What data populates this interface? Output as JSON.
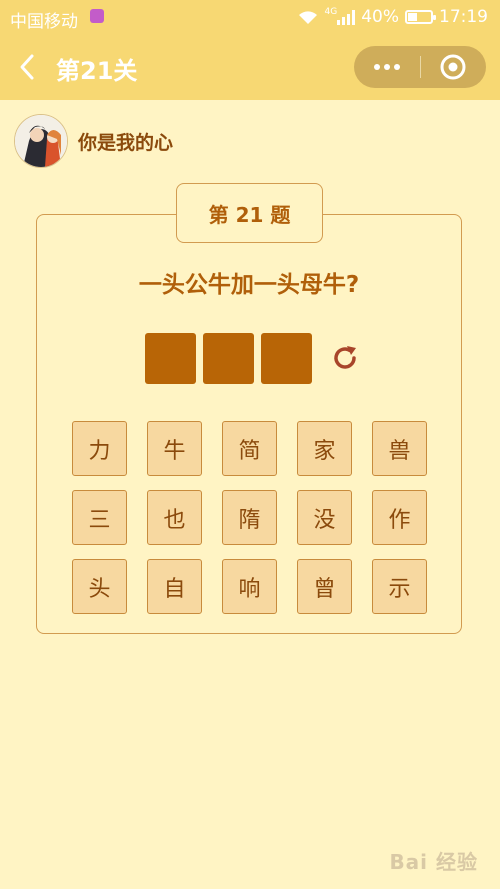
{
  "status_bar": {
    "carrier": "中国移动",
    "network": "4G",
    "battery": "40%",
    "battery_level": 0.4,
    "time": "17:19"
  },
  "nav": {
    "title": "第21关"
  },
  "user": {
    "name": "你是我的心"
  },
  "game": {
    "question_label": "第 21 题",
    "question": "一头公牛加一头母牛?",
    "answer_slots": [
      "",
      "",
      ""
    ],
    "tiles": [
      [
        "力",
        "牛",
        "简",
        "家",
        "兽"
      ],
      [
        "三",
        "也",
        "隋",
        "没",
        "作"
      ],
      [
        "头",
        "自",
        "响",
        "曾",
        "示"
      ]
    ]
  },
  "watermark": "Bai 经验",
  "colors": {
    "header": "#f7d873",
    "background": "#fff4c4",
    "accent": "#b86506",
    "text": "#8b4a0c",
    "tile": "#f7d8a0"
  }
}
